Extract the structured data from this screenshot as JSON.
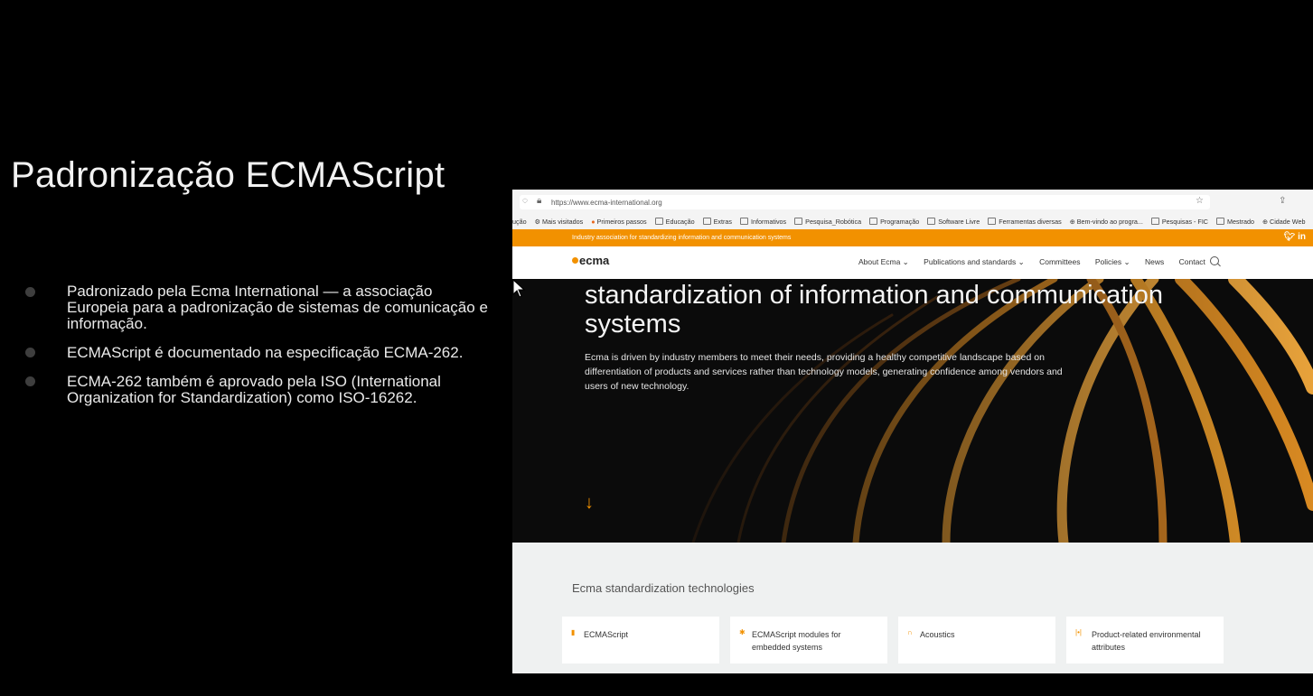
{
  "slide": {
    "title": "Padronização ECMAScript",
    "bullets": [
      "Padronizado pela Ecma International — a associação Europeia para a padronização de sistemas de comunicação e informação.",
      "ECMAScript é documentado na especificação ECMA-262.",
      "ECMA-262 também é aprovado pela ISO (International Organization for Standardization) como ISO-16262."
    ]
  },
  "browser": {
    "url": "https://www.ecma-international.org",
    "bookmarks": [
      "ução",
      "Mais visitados",
      "Primeiros passos",
      "Educação",
      "Extras",
      "Informativos",
      "Pesquisa_Robótica",
      "Programação",
      "Software Livre",
      "Ferramentas diversas",
      "Bem-vindo ao progra...",
      "Pesquisas - FIC",
      "Mestrado",
      "Cidade Web"
    ]
  },
  "site": {
    "top_banner": "Industry association for standardizing information and communication systems",
    "social": "in",
    "logo": "ecma",
    "menu": [
      "About Ecma ⌄",
      "Publications and standards ⌄",
      "Committees",
      "Policies ⌄",
      "News",
      "Contact"
    ],
    "hero_title": "standardization of information and communication systems",
    "hero_text": "Ecma is driven by industry members to meet their needs, providing a healthy competitive landscape based on differentiation of products and services rather than technology models, generating confidence among vendors and users of new technology.",
    "arrow": "↓",
    "tech_title": "Ecma standardization technologies",
    "tech_cards": [
      {
        "icon": "document-icon",
        "label": "ECMAScript"
      },
      {
        "icon": "star-icon",
        "label": "ECMAScript modules for embedded systems"
      },
      {
        "icon": "headphones-icon",
        "label": "Acoustics"
      },
      {
        "icon": "brackets-icon",
        "label": "Product-related environmental attributes"
      }
    ]
  },
  "colors": {
    "accent": "#f29100",
    "background": "#000000"
  }
}
